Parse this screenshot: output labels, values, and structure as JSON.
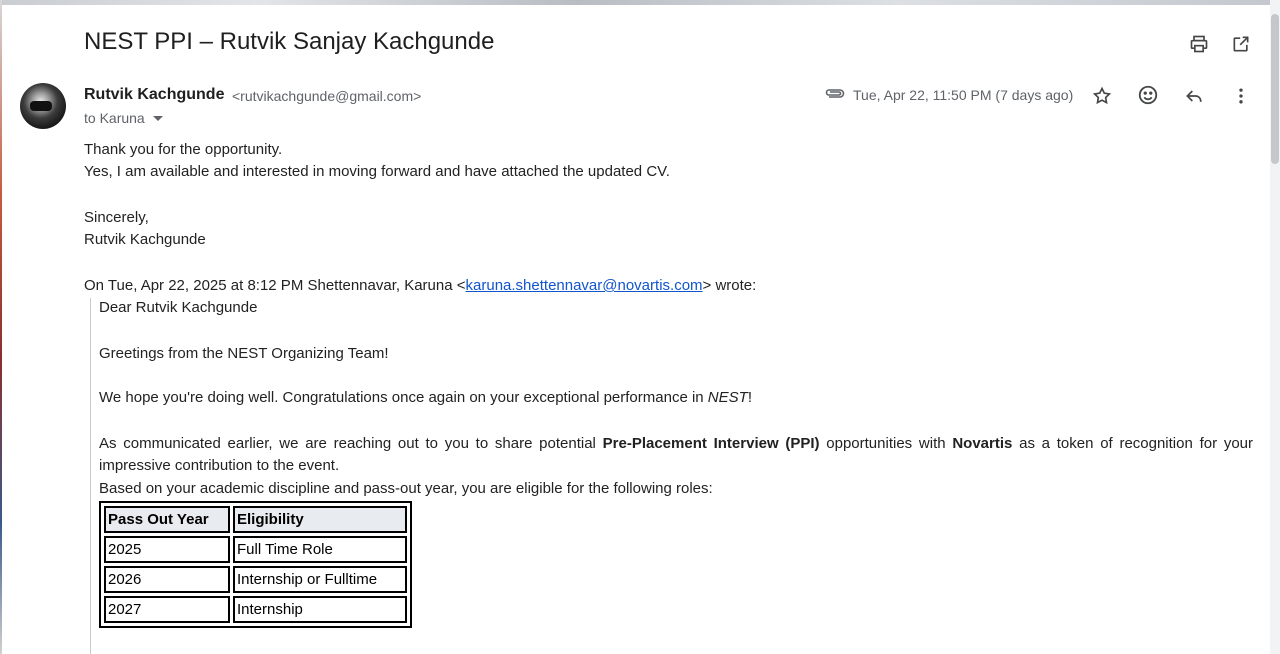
{
  "subject": "NEST PPI – Rutvik Sanjay Kachgunde",
  "header_icons": [
    "print-icon",
    "open-in-new-window-icon"
  ],
  "sender": {
    "name": "Rutvik Kachgunde",
    "email": "<rutvikachgunde@gmail.com>",
    "to": "to Karuna"
  },
  "meta": {
    "date": "Tue, Apr 22, 11:50 PM (7 days ago)",
    "actions": [
      "attachment-icon",
      "star-icon",
      "emoji-reaction-icon",
      "reply-icon",
      "more-options-icon"
    ]
  },
  "reply": {
    "line1": "Thank you for the opportunity.",
    "line2": "Yes, I am available and interested in moving forward and have attached the updated CV.",
    "closing": "Sincerely,",
    "signature": "Rutvik Kachgunde"
  },
  "quote_header": {
    "prefix": "On Tue, Apr 22, 2025 at 8:12 PM Shettennavar, Karuna <",
    "link": "karuna.shettennavar@novartis.com",
    "suffix": "> wrote:"
  },
  "quoted": {
    "greeting": "Dear Rutvik Kachgunde",
    "line1": "Greetings from the NEST Organizing Team!",
    "line2_a": "We hope you're doing well. Congratulations once again on your exceptional performance in ",
    "line2_em": "NEST",
    "line2_b": "!",
    "para_a": "As communicated earlier, we are reaching out to you to share potential ",
    "para_bold1": "Pre-Placement Interview (PPI)",
    "para_b": " opportunities with ",
    "para_bold2": "Novartis",
    "para_c": " as a token of recognition for your impressive contribution to the event.",
    "eligible_line": "Based on your academic discipline and pass-out year, you are eligible for the following roles:"
  },
  "table": {
    "headers": [
      "Pass Out Year",
      "Eligibility"
    ],
    "rows": [
      [
        "2025",
        "Full Time Role"
      ],
      [
        "2026",
        "Internship or Fulltime"
      ],
      [
        "2027",
        "Internship"
      ]
    ]
  }
}
